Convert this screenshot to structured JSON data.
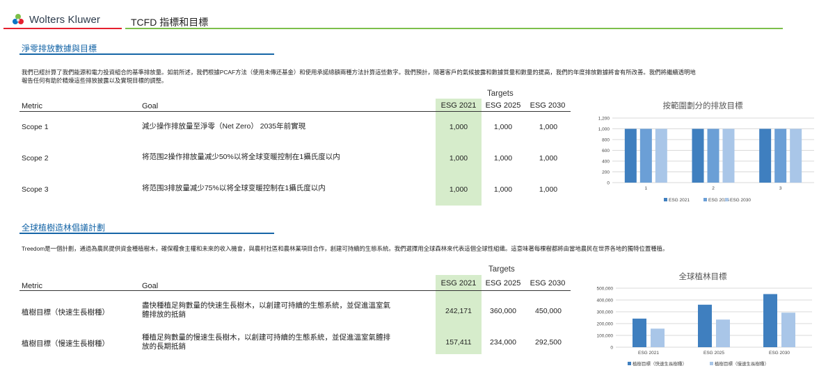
{
  "brand": {
    "name": "Wolters Kluwer"
  },
  "header": {
    "title": "TCFD 指標和目標"
  },
  "section1": {
    "title": "淨零排放數據與目標",
    "intro_line1": "我們已經計算了我們能源和電力投資組合的基準排放量。如前所述，我們根據PCAF方法（使用未傳还基金）和使用承諾總額兩種方法計算這些數字。我們預計，隨著客戶的氣候披露和數據質量和數量的提高，我們的年度排放數據將會有所改善。我們將繼續透明地",
    "intro_line2": "報告任何有助於精煉這些排放披露以及實現目標的調整。",
    "table": {
      "targets_label": "Targets",
      "headers": {
        "metric": "Metric",
        "goal": "Goal",
        "esg2021": "ESG 2021",
        "esg2025": "ESG 2025",
        "esg2030": "ESG 2030"
      },
      "rows": [
        {
          "metric": "Scope 1",
          "goal": "減少操作排放量至淨零（Net Zero） 2035年前實現",
          "v2021": "1,000",
          "v2025": "1,000",
          "v2030": "1,000"
        },
        {
          "metric": "Scope 2",
          "goal": "将范围2操作排放量减少50%以将全球变暖控制在1攝氏度以内",
          "v2021": "1,000",
          "v2025": "1,000",
          "v2030": "1,000"
        },
        {
          "metric": "Scope 3",
          "goal": "将范围3排放量减少75%以将全球变暖控制在1攝氏度以内",
          "v2021": "1,000",
          "v2025": "1,000",
          "v2030": "1,000"
        }
      ]
    }
  },
  "section2": {
    "title": "全球植樹造林倡議計劃",
    "intro": "Treedom是一個計劃，通過為農民提供資金種植樹木，確保糧食主權和未來的收入機會，與農村社區和農林業項目合作，創建可持續的生態系統。我們選擇用全球森林來代表這個全球性組織。這意味著每棵樹都將由當地農民在世界各地的獨特位置種植。",
    "table": {
      "targets_label": "Targets",
      "headers": {
        "metric": "Metric",
        "goal": "Goal",
        "esg2021": "ESG 2021",
        "esg2025": "ESG 2025",
        "esg2030": "ESG 2030"
      },
      "rows": [
        {
          "metric": "植樹目標（快速生長樹種）",
          "goal_line1": "盡快種植足夠數量的快速生長樹木，以創建可持續的生態系統，並促進溫室氣",
          "goal_line2": "體排放的抵銷",
          "v2021": "242,171",
          "v2025": "360,000",
          "v2030": "450,000"
        },
        {
          "metric": "植樹目標（慢速生長樹種）",
          "goal_line1": "種植足夠數量的慢速生長樹木，以創建可持續的生態系統，並促進溫室氣體排",
          "goal_line2": "放的長期抵銷",
          "v2021": "157,411",
          "v2025": "234,000",
          "v2030": "292,500"
        }
      ]
    }
  },
  "colors": {
    "series1": "#3f7fbf",
    "series2": "#6b9fd6",
    "series3": "#a9c6e8",
    "highlight": "#d6eccb",
    "accent": "#1565a7"
  },
  "chart_data": [
    {
      "type": "bar",
      "title": "按範圍劃分的排放目標",
      "categories": [
        "1",
        "2",
        "3"
      ],
      "series": [
        {
          "name": "ESG 2021",
          "values": [
            1000,
            1000,
            1000
          ]
        },
        {
          "name": "ESG 2025",
          "values": [
            1000,
            1000,
            1000
          ]
        },
        {
          "name": "ESG 2030",
          "values": [
            1000,
            1000,
            1000
          ]
        }
      ],
      "ylim": [
        0,
        1200
      ],
      "yticks": [
        "0",
        "200",
        "400",
        "600",
        "800",
        "1,000",
        "1,200"
      ],
      "grid": true,
      "legend": "bottom"
    },
    {
      "type": "bar",
      "title": "全球植林目標",
      "categories": [
        "ESG 2021",
        "ESG 2025",
        "ESG 2030"
      ],
      "series": [
        {
          "name": "植樹目標（快速生長樹種）",
          "values": [
            242171,
            360000,
            450000
          ]
        },
        {
          "name": "植樹目標（慢速生長樹種）",
          "values": [
            157411,
            234000,
            292500
          ]
        }
      ],
      "ylim": [
        0,
        500000
      ],
      "yticks": [
        "0",
        "100,000",
        "200,000",
        "300,000",
        "400,000",
        "500,000"
      ],
      "grid": true,
      "legend": "bottom"
    }
  ]
}
